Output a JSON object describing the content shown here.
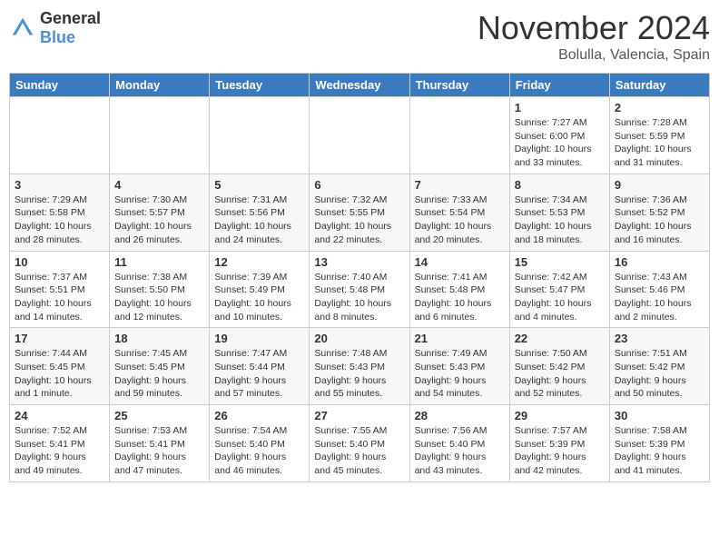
{
  "header": {
    "logo_general": "General",
    "logo_blue": "Blue",
    "month_title": "November 2024",
    "location": "Bolulla, Valencia, Spain"
  },
  "days_of_week": [
    "Sunday",
    "Monday",
    "Tuesday",
    "Wednesday",
    "Thursday",
    "Friday",
    "Saturday"
  ],
  "weeks": [
    [
      {
        "day": "",
        "info": ""
      },
      {
        "day": "",
        "info": ""
      },
      {
        "day": "",
        "info": ""
      },
      {
        "day": "",
        "info": ""
      },
      {
        "day": "",
        "info": ""
      },
      {
        "day": "1",
        "info": "Sunrise: 7:27 AM\nSunset: 6:00 PM\nDaylight: 10 hours and 33 minutes."
      },
      {
        "day": "2",
        "info": "Sunrise: 7:28 AM\nSunset: 5:59 PM\nDaylight: 10 hours and 31 minutes."
      }
    ],
    [
      {
        "day": "3",
        "info": "Sunrise: 7:29 AM\nSunset: 5:58 PM\nDaylight: 10 hours and 28 minutes."
      },
      {
        "day": "4",
        "info": "Sunrise: 7:30 AM\nSunset: 5:57 PM\nDaylight: 10 hours and 26 minutes."
      },
      {
        "day": "5",
        "info": "Sunrise: 7:31 AM\nSunset: 5:56 PM\nDaylight: 10 hours and 24 minutes."
      },
      {
        "day": "6",
        "info": "Sunrise: 7:32 AM\nSunset: 5:55 PM\nDaylight: 10 hours and 22 minutes."
      },
      {
        "day": "7",
        "info": "Sunrise: 7:33 AM\nSunset: 5:54 PM\nDaylight: 10 hours and 20 minutes."
      },
      {
        "day": "8",
        "info": "Sunrise: 7:34 AM\nSunset: 5:53 PM\nDaylight: 10 hours and 18 minutes."
      },
      {
        "day": "9",
        "info": "Sunrise: 7:36 AM\nSunset: 5:52 PM\nDaylight: 10 hours and 16 minutes."
      }
    ],
    [
      {
        "day": "10",
        "info": "Sunrise: 7:37 AM\nSunset: 5:51 PM\nDaylight: 10 hours and 14 minutes."
      },
      {
        "day": "11",
        "info": "Sunrise: 7:38 AM\nSunset: 5:50 PM\nDaylight: 10 hours and 12 minutes."
      },
      {
        "day": "12",
        "info": "Sunrise: 7:39 AM\nSunset: 5:49 PM\nDaylight: 10 hours and 10 minutes."
      },
      {
        "day": "13",
        "info": "Sunrise: 7:40 AM\nSunset: 5:48 PM\nDaylight: 10 hours and 8 minutes."
      },
      {
        "day": "14",
        "info": "Sunrise: 7:41 AM\nSunset: 5:48 PM\nDaylight: 10 hours and 6 minutes."
      },
      {
        "day": "15",
        "info": "Sunrise: 7:42 AM\nSunset: 5:47 PM\nDaylight: 10 hours and 4 minutes."
      },
      {
        "day": "16",
        "info": "Sunrise: 7:43 AM\nSunset: 5:46 PM\nDaylight: 10 hours and 2 minutes."
      }
    ],
    [
      {
        "day": "17",
        "info": "Sunrise: 7:44 AM\nSunset: 5:45 PM\nDaylight: 10 hours and 1 minute."
      },
      {
        "day": "18",
        "info": "Sunrise: 7:45 AM\nSunset: 5:45 PM\nDaylight: 9 hours and 59 minutes."
      },
      {
        "day": "19",
        "info": "Sunrise: 7:47 AM\nSunset: 5:44 PM\nDaylight: 9 hours and 57 minutes."
      },
      {
        "day": "20",
        "info": "Sunrise: 7:48 AM\nSunset: 5:43 PM\nDaylight: 9 hours and 55 minutes."
      },
      {
        "day": "21",
        "info": "Sunrise: 7:49 AM\nSunset: 5:43 PM\nDaylight: 9 hours and 54 minutes."
      },
      {
        "day": "22",
        "info": "Sunrise: 7:50 AM\nSunset: 5:42 PM\nDaylight: 9 hours and 52 minutes."
      },
      {
        "day": "23",
        "info": "Sunrise: 7:51 AM\nSunset: 5:42 PM\nDaylight: 9 hours and 50 minutes."
      }
    ],
    [
      {
        "day": "24",
        "info": "Sunrise: 7:52 AM\nSunset: 5:41 PM\nDaylight: 9 hours and 49 minutes."
      },
      {
        "day": "25",
        "info": "Sunrise: 7:53 AM\nSunset: 5:41 PM\nDaylight: 9 hours and 47 minutes."
      },
      {
        "day": "26",
        "info": "Sunrise: 7:54 AM\nSunset: 5:40 PM\nDaylight: 9 hours and 46 minutes."
      },
      {
        "day": "27",
        "info": "Sunrise: 7:55 AM\nSunset: 5:40 PM\nDaylight: 9 hours and 45 minutes."
      },
      {
        "day": "28",
        "info": "Sunrise: 7:56 AM\nSunset: 5:40 PM\nDaylight: 9 hours and 43 minutes."
      },
      {
        "day": "29",
        "info": "Sunrise: 7:57 AM\nSunset: 5:39 PM\nDaylight: 9 hours and 42 minutes."
      },
      {
        "day": "30",
        "info": "Sunrise: 7:58 AM\nSunset: 5:39 PM\nDaylight: 9 hours and 41 minutes."
      }
    ]
  ]
}
